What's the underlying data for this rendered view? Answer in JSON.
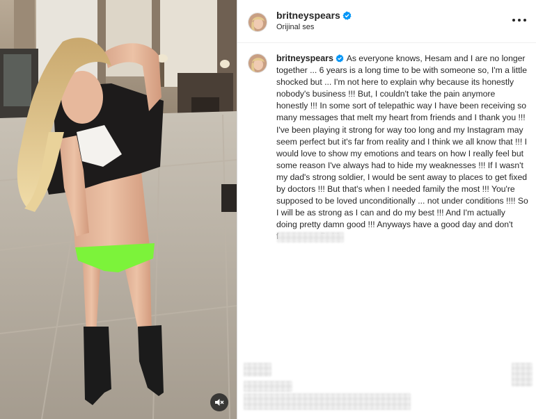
{
  "post": {
    "username": "britneyspears",
    "audio_label": "Orijinal ses",
    "verified": true,
    "caption": "As everyone knows, Hesam and I are no longer together ... 6 years is a long time to be with someone so, I'm a little shocked but ... I'm not here to explain why because its honestly nobody's business !!! But, I couldn't take the pain anymore honestly !!! In some sort of telepathic way I have been receiving so many messages that melt my heart from friends and I thank you !!! I've been playing it strong for way too long and my Instagram may seem perfect but it's far from reality and I think we all know that !!! I would love to show my emotions and tears on how I really feel but some reason I've always had to hide my weaknesses !!! If I wasn't my dad's strong soldier, I would be sent away to places to get fixed by doctors !!! But that's when I needed family the most !!! You're supposed to be loved unconditionally ... not under conditions !!!! So I will be as strong as I can and do my best !!! And I'm actually doing pretty damn good !!! Anyways have a good day and don't forget to smile !!!"
  },
  "media": {
    "type": "video",
    "sound_icon": "muted-speaker-icon"
  },
  "icons": {
    "verified": "verified-badge-icon",
    "more": "more-options-icon"
  },
  "colors": {
    "verified_blue": "#0095f6",
    "text": "#262626",
    "border": "#dbdbdb"
  }
}
